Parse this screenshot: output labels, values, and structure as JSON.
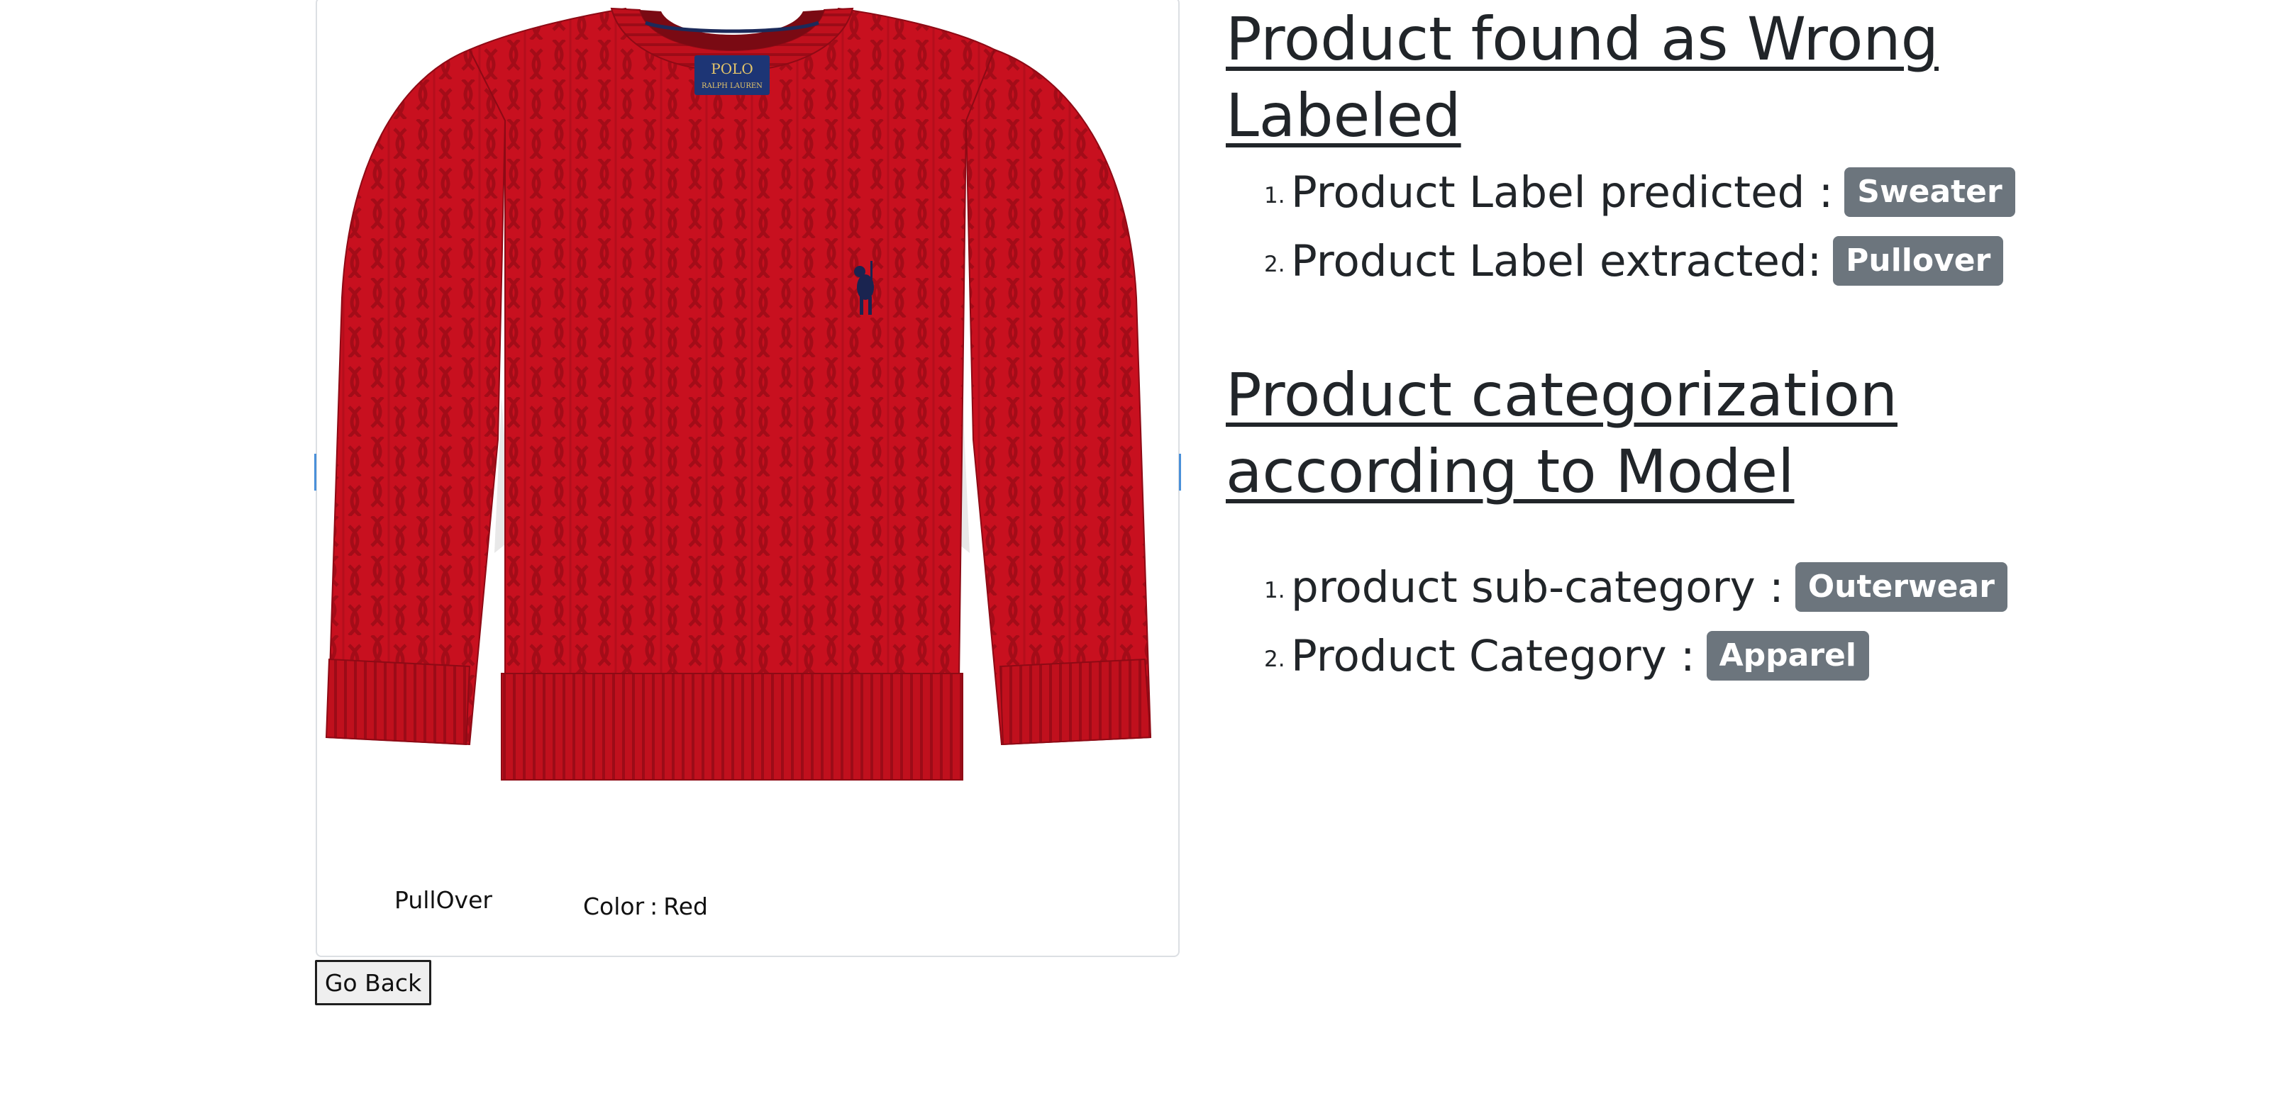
{
  "product": {
    "image_alt": "Red cable-knit crew neck sweater",
    "logo_text": "POLO",
    "logo_subtext": "RALPH LAUREN",
    "name": "PullOver",
    "color_label": "Color",
    "color_separator": ":",
    "color_value": "Red"
  },
  "actions": {
    "go_back_label": "Go Back"
  },
  "wrong_label_section": {
    "heading": "Product found as Wrong Labeled",
    "items": [
      {
        "number": "1.",
        "label": "Product Label predicted :",
        "value": "Sweater"
      },
      {
        "number": "2.",
        "label": "Product Label extracted:",
        "value": "Pullover"
      }
    ]
  },
  "categorization_section": {
    "heading": "Product categorization according to Model",
    "items": [
      {
        "number": "1.",
        "label": "product sub-category :",
        "value": "Outerwear"
      },
      {
        "number": "2.",
        "label": "Product Category :",
        "value": "Apparel"
      }
    ]
  },
  "colors": {
    "sweater": "#c8101f",
    "badge_bg": "#6c757d",
    "heading_text": "#212529",
    "card_border": "#dcdfe3"
  }
}
